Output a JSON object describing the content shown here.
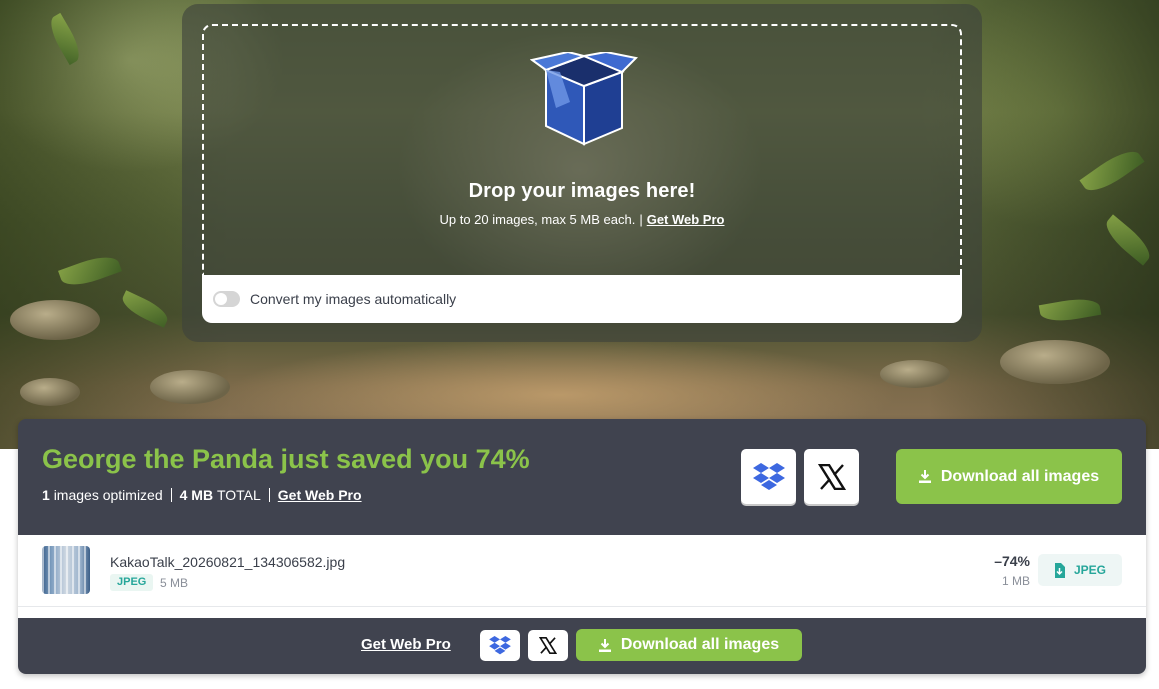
{
  "upload": {
    "title": "Drop your images here!",
    "subtitle": "Up to 20 images, max 5 MB each.",
    "separator": "|",
    "pro_link": "Get Web Pro",
    "convert_label": "Convert my images automatically",
    "convert_enabled": false
  },
  "summary": {
    "headline": "George the Panda just saved you 74%",
    "count_number": "1",
    "count_label": "images optimized",
    "total_size": "4 MB",
    "total_label": "TOTAL",
    "pro_link": "Get Web Pro",
    "download_all": "Download all images",
    "dropbox_icon": "dropbox-icon",
    "x_icon": "x-icon"
  },
  "files": [
    {
      "name": "KakaoTalk_20260821_134306582.jpg",
      "type": "JPEG",
      "size": "5 MB",
      "saving": "–74%",
      "new_size": "1 MB",
      "download_label": "JPEG"
    }
  ],
  "footer": {
    "pro_link": "Get Web Pro",
    "download_all": "Download all images"
  },
  "colors": {
    "accent_green": "#8bc34a",
    "panel_dark": "#40434f",
    "teal": "#26a69a"
  }
}
